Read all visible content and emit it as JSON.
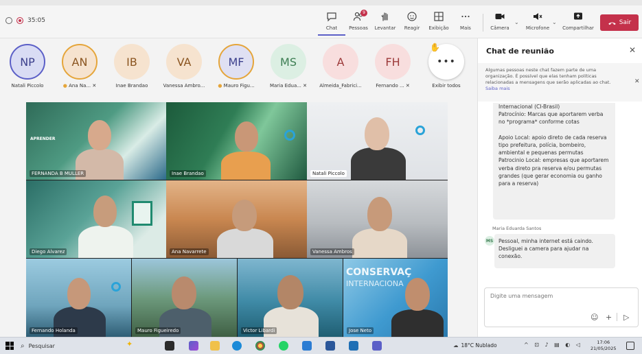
{
  "toolbar": {
    "timer": "35:05",
    "buttons": [
      {
        "id": "chat",
        "label": "Chat",
        "icon": "chat-icon"
      },
      {
        "id": "people",
        "label": "Pessoas",
        "icon": "people-icon",
        "badge": "9"
      },
      {
        "id": "raise",
        "label": "Levantar",
        "icon": "hand-icon"
      },
      {
        "id": "react",
        "label": "Reagir",
        "icon": "smile-icon"
      },
      {
        "id": "view",
        "label": "Exibição",
        "icon": "grid-icon"
      },
      {
        "id": "more",
        "label": "Mais",
        "icon": "more-icon"
      },
      {
        "id": "camera",
        "label": "Câmera",
        "icon": "camera-icon"
      },
      {
        "id": "mic",
        "label": "Microfone",
        "icon": "microphone-icon"
      },
      {
        "id": "share",
        "label": "Compartilhar",
        "icon": "share-icon"
      }
    ],
    "leave_label": "Sair"
  },
  "participants": [
    {
      "initials": "NP",
      "name": "Natali Piccolo",
      "bg": "#d9dcf4",
      "fg": "#3b3f8c",
      "ring": "#5b5fc7"
    },
    {
      "initials": "AN",
      "name": "Ana Na...",
      "bg": "#f6e3cf",
      "fg": "#8a5520",
      "ring": "#e5a53a"
    },
    {
      "initials": "IB",
      "name": "Inae Brandao",
      "bg": "#f6e3cf",
      "fg": "#8a5520",
      "ring": ""
    },
    {
      "initials": "VA",
      "name": "Vanessa Ambro...",
      "bg": "#f6e3cf",
      "fg": "#8a5520",
      "ring": ""
    },
    {
      "initials": "MF",
      "name": "Mauro Figu...",
      "bg": "#dfe0f3",
      "fg": "#3b3f8c",
      "ring": "#e5a53a"
    },
    {
      "initials": "MS",
      "name": "Maria Edua...",
      "bg": "#dcefe3",
      "fg": "#3c7d52",
      "ring": ""
    },
    {
      "initials": "A",
      "name": "Almeida_Fabrici...",
      "bg": "#f8dede",
      "fg": "#9c3a3a",
      "ring": ""
    },
    {
      "initials": "FH",
      "name": "Fernando ...",
      "bg": "#f8dede",
      "fg": "#9c3a3a",
      "ring": ""
    }
  ],
  "show_all": {
    "label": "Exibir todos",
    "icon": "more-icon"
  },
  "videos": [
    {
      "name": "FERNANDA B MULLER",
      "bg": "#2f6b58",
      "accent": "#e8f1ee"
    },
    {
      "name": "Inae Brandao",
      "bg": "#2a6d4a",
      "accent": "#6bb08a"
    },
    {
      "name": "Natali Piccolo",
      "bg": "#e8ebef",
      "accent": "#ffffff"
    },
    {
      "name": "Diego Alvarez",
      "bg": "#43827a",
      "accent": "#d8ece6"
    },
    {
      "name": "Ana Navarrete",
      "bg": "#c58a55",
      "accent": "#f0c08a"
    },
    {
      "name": "Vanessa Ambros",
      "bg": "#c9cdd2",
      "accent": "#8a9096"
    },
    {
      "name": "Fernando Holanda",
      "bg": "#7fb3c8",
      "accent": "#e8f2f6"
    },
    {
      "name": "Mauro Figueiredo",
      "bg": "#5d8b6a",
      "accent": "#9ac4d9"
    },
    {
      "name": "Victor Libardi",
      "bg": "#6aa0b8",
      "accent": "#1f5e73"
    },
    {
      "name": "Jose Neto",
      "bg": "#3f9ad0",
      "accent": "#c7e4f4"
    }
  ],
  "video_texts": {
    "aprender": "APRENDER",
    "conservacao": "CONSERVAÇ",
    "internacional": "INTERNACIONA"
  },
  "chat": {
    "title": "Chat de reunião",
    "notice": "Algumas pessoas neste chat fazem parte de uma organização. É possível que elas tenham políticas relacionadas a mensagens que serão aplicadas ao chat.",
    "notice_link": "Saiba mais",
    "message1": "Internacional (CI-Brasil)\nPatrocínio: Marcas que aportarem verba no *programa* conforme cotas\n\nApoio Local: apoio direto de cada reserva tipo prefeitura, polícia, bombeiro, ambiental e pequenas permutas\nPatrocinio Local: empresas que aportarem verba direto pra reserva e/ou permutas grandes (que gerar economia ou ganho para a reserva)",
    "sender2": "Maria Eduarda Santos",
    "sender2_initials": "MS",
    "message2": "Pessoal, minha internet está caindo. Desliguei a camera para ajudar na conexão.",
    "compose_placeholder": "Digite uma mensagem"
  },
  "taskbar": {
    "search_label": "Pesquisar",
    "weather": "18°C Nublado",
    "time": "17:06",
    "date": "21/05/2025"
  }
}
